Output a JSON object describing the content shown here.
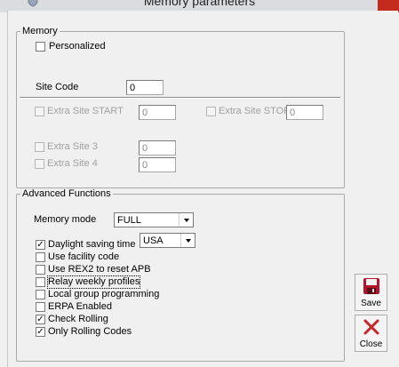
{
  "window": {
    "title": "Memory parameters",
    "app_icon": "shield-icon",
    "close_icon": "close-icon"
  },
  "memory": {
    "legend": "Memory",
    "personalized": {
      "label": "Personalized",
      "checked": false
    },
    "site_code": {
      "label": "Site Code",
      "value": "0"
    },
    "extra_site_start": {
      "label": "Extra Site START",
      "value": "0",
      "checked": false
    },
    "extra_site_stop": {
      "label": "Extra Site STOP",
      "value": "0",
      "checked": false
    },
    "extra_site_3": {
      "label": "Extra Site 3",
      "value": "0",
      "checked": false
    },
    "extra_site_4": {
      "label": "Extra Site 4",
      "value": "0",
      "checked": false
    }
  },
  "advanced": {
    "legend": "Advanced Functions",
    "memory_mode": {
      "label": "Memory mode",
      "value": "FULL"
    },
    "daylight_region": {
      "value": "USA"
    },
    "options": [
      {
        "label": "Daylight saving time",
        "checked": true
      },
      {
        "label": "Use facility code",
        "checked": false
      },
      {
        "label": "Use REX2 to reset APB",
        "checked": false
      },
      {
        "label": "Relay weekly profiles",
        "checked": false
      },
      {
        "label": "Local group programming",
        "checked": false
      },
      {
        "label": "ERPA Enabled",
        "checked": false
      },
      {
        "label": "Check Rolling",
        "checked": true
      },
      {
        "label": "Only Rolling Codes",
        "checked": true
      }
    ]
  },
  "buttons": {
    "save": {
      "label": "Save",
      "icon": "floppy-disk-icon"
    },
    "close": {
      "label": "Close",
      "icon": "red-x-icon"
    }
  },
  "colors": {
    "title_close": "#c42b1c",
    "close_icon": "#c62828",
    "save_icon": "#b3142c"
  }
}
